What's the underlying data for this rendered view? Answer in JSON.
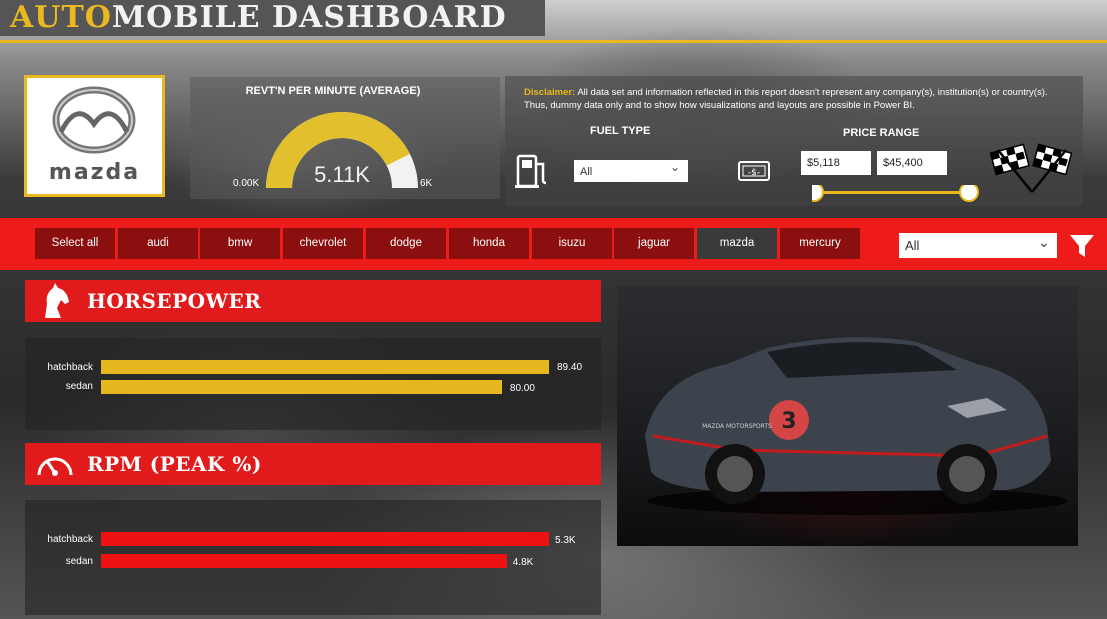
{
  "header": {
    "title_highlight": "AUTO",
    "title_rest": "MOBILE DASHBOARD"
  },
  "logo": {
    "brand_text": "mazda"
  },
  "gauge": {
    "title": "REVT'N PER MINUTE (AVERAGE)",
    "value_label": "5.11K",
    "min_label": "0.00K",
    "max_label": "6K",
    "value": 5.11,
    "max": 6
  },
  "disclaimer": {
    "label": "Disclaimer:",
    "text": " All data set and information reflected in this report doesn't represent any company(s), institution(s) or country(s). Thus, dummy data only and to show how visualizations and layouts are possible in Power BI."
  },
  "fuel_type": {
    "label": "FUEL TYPE",
    "selected": "All"
  },
  "price_range": {
    "label": "PRICE RANGE",
    "min": "$5,118",
    "max": "$45,400"
  },
  "brands": {
    "select_all": "Select all",
    "items": [
      "audi",
      "bmw",
      "chevrolet",
      "dodge",
      "honda",
      "isuzu",
      "jaguar",
      "mazda",
      "mercury"
    ],
    "selected": "mazda"
  },
  "body_type_filter": {
    "selected": "All"
  },
  "horsepower": {
    "title": "HORSEPOWER",
    "rows": [
      {
        "label": "hatchback",
        "value": 89.4,
        "value_label": "89.40"
      },
      {
        "label": "sedan",
        "value": 80.0,
        "value_label": "80.00"
      }
    ]
  },
  "rpm": {
    "title": "RPM (PEAK %)",
    "rows": [
      {
        "label": "hatchback",
        "value": 5300,
        "value_label": "5.3K"
      },
      {
        "label": "sedan",
        "value": 4800,
        "value_label": "4.8K"
      }
    ]
  },
  "colors": {
    "accent_gold": "#e9b91e",
    "accent_red": "#ee1b1b",
    "brand_btn": "#8c0f0f",
    "brand_btn_selected": "#3a3a3a"
  },
  "car_photo": {
    "decal_number": "3",
    "decal_text": "MAZDA MOTORSPORTS"
  }
}
